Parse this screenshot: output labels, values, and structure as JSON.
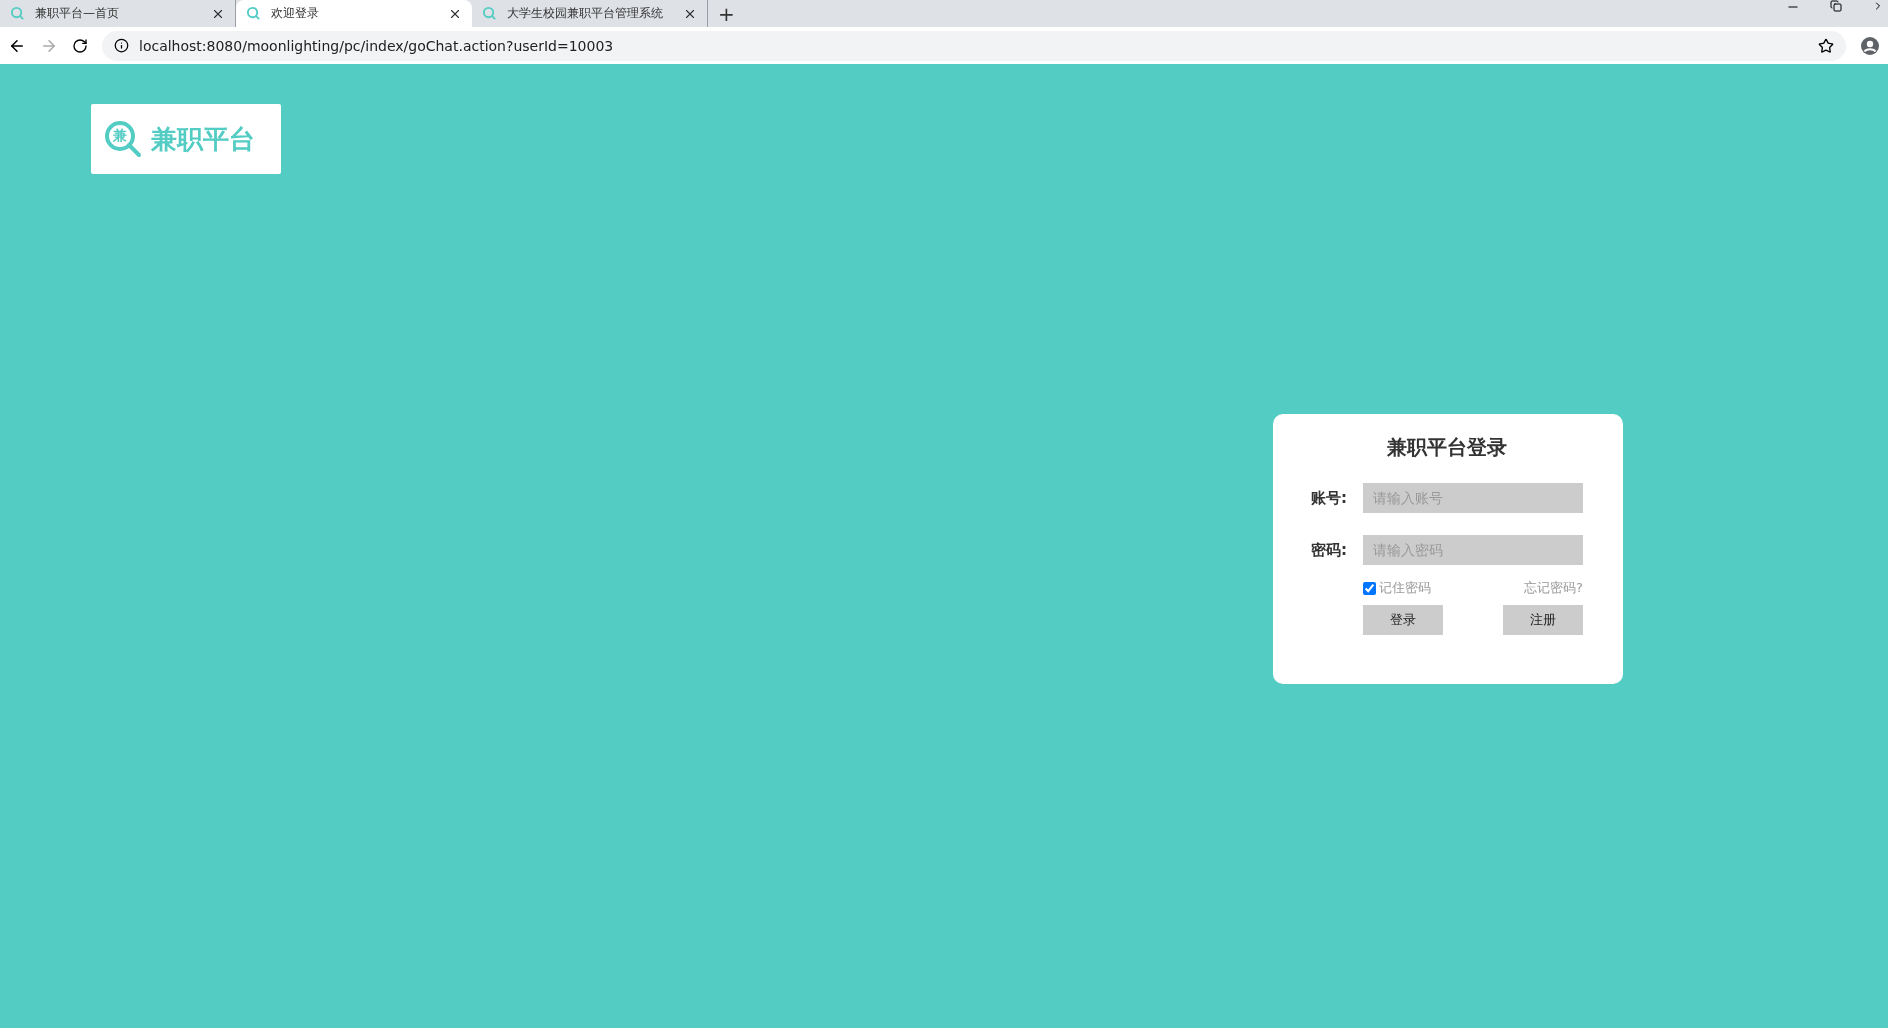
{
  "browser": {
    "tabs": [
      {
        "title": "兼职平台—首页",
        "selected": false
      },
      {
        "title": "欢迎登录",
        "selected": true
      },
      {
        "title": "大学生校园兼职平台管理系统",
        "selected": false
      }
    ],
    "new_tab": "+",
    "url": "localhost:8080/moonlighting/pc/index/goChat.action?userId=10003"
  },
  "logo": {
    "mark": "兼",
    "name": "兼职平台"
  },
  "login": {
    "title": "兼职平台登录",
    "fields": [
      {
        "label": "账号:",
        "placeholder": "请输入账号"
      },
      {
        "label": "密码:",
        "placeholder": "请输入密码"
      }
    ],
    "remember": {
      "label": "记住密码",
      "checked": true
    },
    "forgot": "忘记密码?",
    "buttons": [
      "登录",
      "注册"
    ]
  }
}
